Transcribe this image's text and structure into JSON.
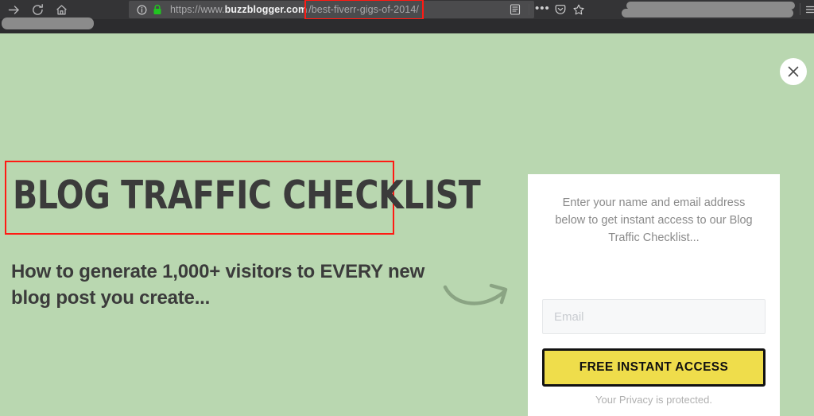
{
  "browser": {
    "nav": {
      "forward_label": "Forward",
      "reload_label": "Reload",
      "home_label": "Home"
    },
    "urlbar": {
      "identity_icon": "info-circle-icon",
      "lock_icon": "green-padlock-icon",
      "lock_color": "#21c521",
      "scheme": "https://www.",
      "host": "buzzblogger.com",
      "path": "/best-fiverr-gigs-of-2014/",
      "path_highlight_color": "#ff1a13"
    },
    "toolbar_icons": [
      {
        "name": "reader-mode-icon",
        "label": "Reader View"
      },
      {
        "name": "page-actions-dots-icon",
        "label": "•••"
      },
      {
        "name": "pocket-icon",
        "label": "Save to Pocket"
      },
      {
        "name": "bookmark-star-icon",
        "label": "Bookmark this page"
      },
      {
        "name": "hamburger-menu-icon",
        "label": "Open menu"
      }
    ],
    "redacted_items": [
      {
        "name": "redacted-toolbar-bar-1"
      },
      {
        "name": "redacted-toolbar-bar-2"
      },
      {
        "name": "redacted-bookmark-item"
      }
    ]
  },
  "page": {
    "background_color": "#b9d7b0",
    "close_button": {
      "icon": "close-x-icon",
      "label": "Close"
    },
    "headline": "BLOG TRAFFIC CHECKLIST",
    "headline_highlight_color": "#ff1a13",
    "subheadline": "How to generate 1,000+ visitors to EVERY new blog post you create...",
    "arrow": {
      "icon": "curved-arrow-right-icon",
      "color": "#7e9677"
    },
    "optin": {
      "intro": "Enter your name and email address below to get instant access to our Blog Traffic Checklist...",
      "email_placeholder": "Email",
      "email_value": "",
      "cta_label": "FREE INSTANT ACCESS",
      "cta_background": "#efdd4b",
      "privacy_note": "Your Privacy is protected."
    }
  }
}
